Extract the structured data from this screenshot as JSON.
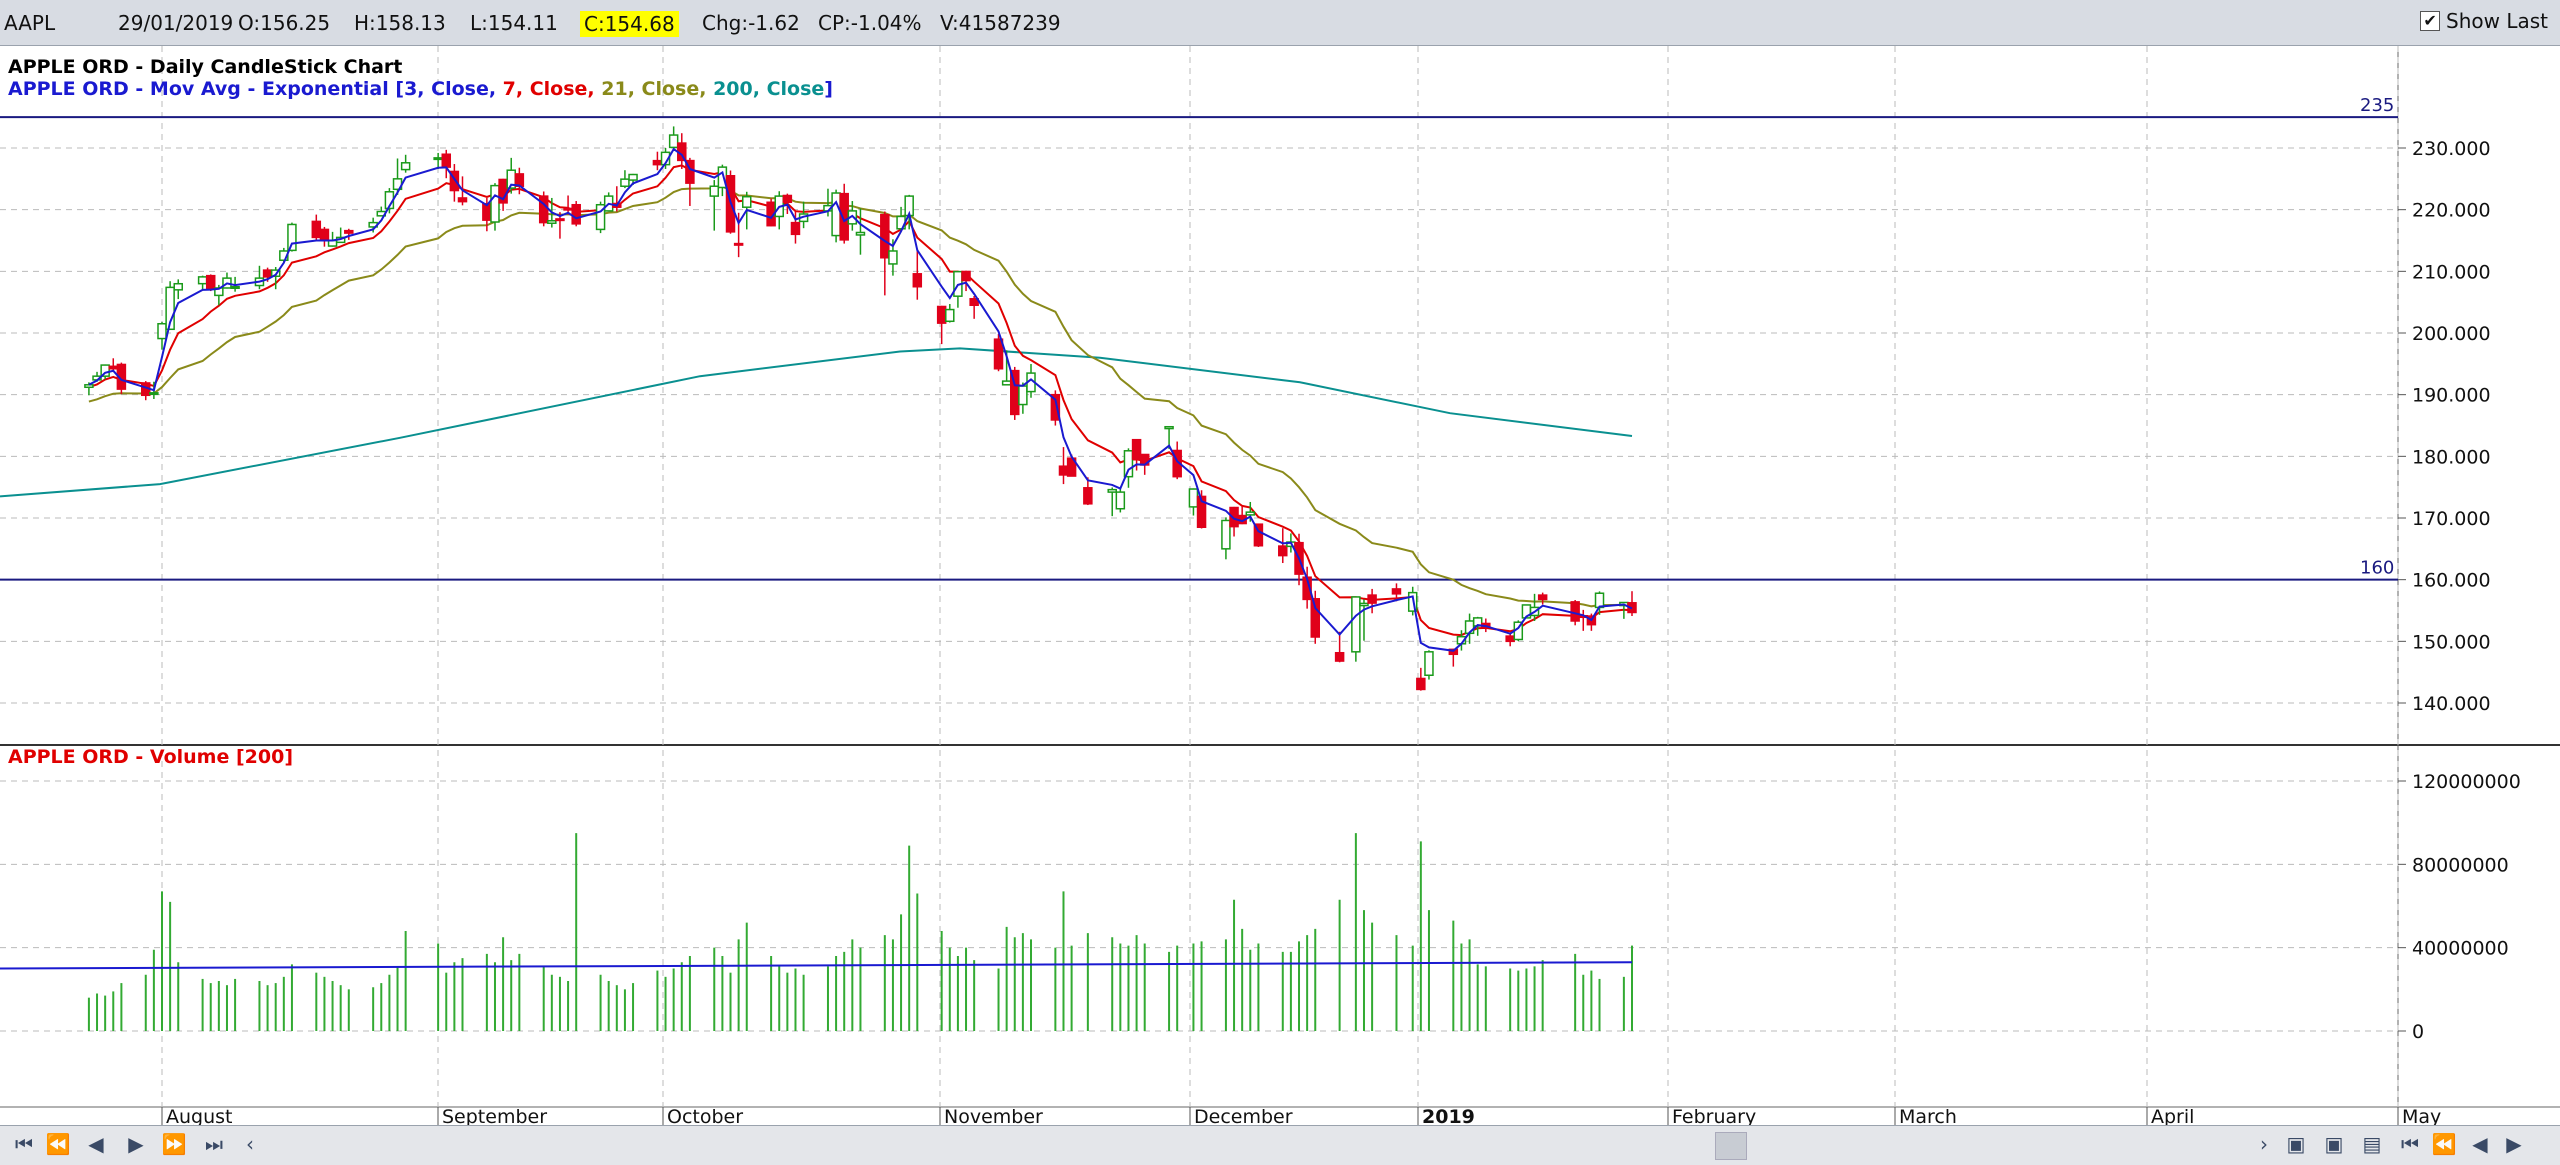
{
  "quote": {
    "symbol": "AAPL",
    "date": "29/01/2019",
    "open": "O:156.25",
    "high": "H:158.13",
    "low": "L:154.11",
    "close": "C:154.68",
    "change": "Chg:-1.62",
    "change_pct": "CP:-1.04%",
    "volume": "V:41587239",
    "show_last_label": "Show Last",
    "show_last_checked": true
  },
  "legend": {
    "price_title": "APPLE ORD - Daily CandleStick Chart",
    "ma_prefix": "APPLE ORD - Mov Avg - Exponential [",
    "ma_parts": [
      {
        "text": "3, Close",
        "color": "#1a1ad0"
      },
      {
        "text": "7, Close",
        "color": "#e00000"
      },
      {
        "text": "21, Close",
        "color": "#8a8a1a"
      },
      {
        "text": "200, Close",
        "color": "#0a9090"
      }
    ],
    "ma_suffix": "]",
    "volume_title": "APPLE ORD - Volume [200]"
  },
  "colors": {
    "up": "#1a9a1a",
    "down": "#e0001a",
    "ema3": "#1a1ad0",
    "ema7": "#e00000",
    "ema21": "#8a8a1a",
    "ema200": "#0a9090",
    "vol_bar": "#33aa33",
    "vol_ma": "#1a1ad0",
    "hline": "#1a1a80"
  },
  "nav_icons": [
    "first-icon",
    "rewind-icon",
    "step-back-icon",
    "step-forward-icon",
    "fast-forward-icon",
    "last-icon",
    "scroll-left-icon"
  ],
  "chart_data": {
    "type": "candlestick",
    "x_axis_labels": [
      "August",
      "September",
      "October",
      "November",
      "December",
      "2019",
      "February",
      "March",
      "April",
      "May"
    ],
    "price_axis": {
      "ylim": [
        134,
        236
      ],
      "ticks": [
        "230.000",
        "220.000",
        "210.000",
        "200.000",
        "190.000",
        "180.000",
        "170.000",
        "160.000",
        "150.000",
        "140.000"
      ]
    },
    "volume_axis": {
      "ylim": [
        -20000000,
        128000000
      ],
      "ticks": [
        "120000000",
        "80000000",
        "40000000",
        "0"
      ]
    },
    "horizontal_lines": [
      {
        "value": 235,
        "label": "235"
      },
      {
        "value": 160,
        "label": "160"
      }
    ],
    "candles": [
      {
        "d": "2018-07-23",
        "o": 191.2,
        "h": 192.0,
        "l": 189.9,
        "c": 191.6
      },
      {
        "d": "2018-07-24",
        "o": 192.4,
        "h": 193.7,
        "l": 192.1,
        "c": 193.0
      },
      {
        "d": "2018-07-25",
        "o": 193.0,
        "h": 194.9,
        "l": 192.5,
        "c": 194.8
      },
      {
        "d": "2018-07-26",
        "o": 194.6,
        "h": 195.9,
        "l": 193.8,
        "c": 194.2
      },
      {
        "d": "2018-07-27",
        "o": 194.9,
        "h": 195.2,
        "l": 190.1,
        "c": 190.9
      },
      {
        "d": "2018-07-30",
        "o": 191.9,
        "h": 192.2,
        "l": 189.1,
        "c": 189.9
      },
      {
        "d": "2018-07-31",
        "o": 190.3,
        "h": 192.1,
        "l": 189.3,
        "c": 190.3
      },
      {
        "d": "2018-08-01",
        "o": 199.1,
        "h": 201.8,
        "l": 197.3,
        "c": 201.5
      },
      {
        "d": "2018-08-02",
        "o": 200.6,
        "h": 208.4,
        "l": 200.5,
        "c": 207.4
      },
      {
        "d": "2018-08-03",
        "o": 207.0,
        "h": 208.7,
        "l": 205.5,
        "c": 207.99
      },
      {
        "d": "2018-08-06",
        "o": 208.0,
        "h": 209.3,
        "l": 207.1,
        "c": 209.1
      },
      {
        "d": "2018-08-07",
        "o": 209.3,
        "h": 209.5,
        "l": 206.8,
        "c": 207.1
      },
      {
        "d": "2018-08-08",
        "o": 206.1,
        "h": 207.8,
        "l": 204.5,
        "c": 207.3
      },
      {
        "d": "2018-08-09",
        "o": 207.3,
        "h": 209.8,
        "l": 207.2,
        "c": 208.9
      },
      {
        "d": "2018-08-10",
        "o": 207.4,
        "h": 209.1,
        "l": 206.7,
        "c": 207.5
      },
      {
        "d": "2018-08-13",
        "o": 207.7,
        "h": 210.9,
        "l": 207.1,
        "c": 208.9
      },
      {
        "d": "2018-08-14",
        "o": 210.2,
        "h": 210.6,
        "l": 208.3,
        "c": 209.1
      },
      {
        "d": "2018-08-15",
        "o": 209.2,
        "h": 210.7,
        "l": 207.1,
        "c": 210.2
      },
      {
        "d": "2018-08-16",
        "o": 211.8,
        "h": 213.8,
        "l": 211.5,
        "c": 213.3
      },
      {
        "d": "2018-08-17",
        "o": 213.4,
        "h": 217.9,
        "l": 213.2,
        "c": 217.6
      },
      {
        "d": "2018-08-20",
        "o": 218.1,
        "h": 219.2,
        "l": 215.1,
        "c": 215.5
      },
      {
        "d": "2018-08-21",
        "o": 216.8,
        "h": 217.2,
        "l": 214.0,
        "c": 215.0
      },
      {
        "d": "2018-08-22",
        "o": 214.1,
        "h": 216.4,
        "l": 214.0,
        "c": 215.0
      },
      {
        "d": "2018-08-23",
        "o": 214.7,
        "h": 217.1,
        "l": 214.6,
        "c": 215.5
      },
      {
        "d": "2018-08-24",
        "o": 216.6,
        "h": 216.9,
        "l": 215.1,
        "c": 216.2
      },
      {
        "d": "2018-08-27",
        "o": 217.2,
        "h": 218.7,
        "l": 216.3,
        "c": 217.9
      },
      {
        "d": "2018-08-28",
        "o": 219.0,
        "h": 220.5,
        "l": 218.9,
        "c": 219.7
      },
      {
        "d": "2018-08-29",
        "o": 220.2,
        "h": 223.5,
        "l": 219.4,
        "c": 222.9
      },
      {
        "d": "2018-08-30",
        "o": 223.3,
        "h": 228.3,
        "l": 222.4,
        "c": 225.0
      },
      {
        "d": "2018-08-31",
        "o": 226.5,
        "h": 228.9,
        "l": 226.0,
        "c": 227.6
      },
      {
        "d": "2018-09-04",
        "o": 228.4,
        "h": 229.2,
        "l": 226.6,
        "c": 228.4
      },
      {
        "d": "2018-09-05",
        "o": 228.99,
        "h": 229.7,
        "l": 225.1,
        "c": 226.9
      },
      {
        "d": "2018-09-06",
        "o": 226.2,
        "h": 227.4,
        "l": 221.3,
        "c": 223.1
      },
      {
        "d": "2018-09-07",
        "o": 221.9,
        "h": 225.4,
        "l": 220.7,
        "c": 221.3
      },
      {
        "d": "2018-09-10",
        "o": 220.95,
        "h": 221.9,
        "l": 216.5,
        "c": 218.3
      },
      {
        "d": "2018-09-11",
        "o": 218.0,
        "h": 224.3,
        "l": 216.6,
        "c": 223.9
      },
      {
        "d": "2018-09-12",
        "o": 224.9,
        "h": 225.0,
        "l": 219.8,
        "c": 221.1
      },
      {
        "d": "2018-09-13",
        "o": 223.5,
        "h": 228.4,
        "l": 222.6,
        "c": 226.4
      },
      {
        "d": "2018-09-14",
        "o": 225.8,
        "h": 226.8,
        "l": 222.5,
        "c": 223.8
      },
      {
        "d": "2018-09-17",
        "o": 222.2,
        "h": 222.95,
        "l": 217.3,
        "c": 217.9
      },
      {
        "d": "2018-09-18",
        "o": 217.8,
        "h": 221.9,
        "l": 217.1,
        "c": 218.2
      },
      {
        "d": "2018-09-19",
        "o": 218.5,
        "h": 219.6,
        "l": 215.3,
        "c": 218.4
      },
      {
        "d": "2018-09-20",
        "o": 220.2,
        "h": 222.3,
        "l": 219.2,
        "c": 220.0
      },
      {
        "d": "2018-09-21",
        "o": 220.8,
        "h": 221.4,
        "l": 217.3,
        "c": 217.7
      },
      {
        "d": "2018-09-24",
        "o": 216.8,
        "h": 221.3,
        "l": 216.2,
        "c": 220.8
      },
      {
        "d": "2018-09-25",
        "o": 219.8,
        "h": 222.8,
        "l": 219.7,
        "c": 222.2
      },
      {
        "d": "2018-09-26",
        "o": 221.0,
        "h": 223.8,
        "l": 219.7,
        "c": 220.4
      },
      {
        "d": "2018-09-27",
        "o": 223.8,
        "h": 226.4,
        "l": 223.5,
        "c": 224.95
      },
      {
        "d": "2018-09-28",
        "o": 224.8,
        "h": 225.8,
        "l": 224.0,
        "c": 225.7
      },
      {
        "d": "2018-10-01",
        "o": 227.95,
        "h": 229.4,
        "l": 226.4,
        "c": 227.3
      },
      {
        "d": "2018-10-02",
        "o": 227.3,
        "h": 230.0,
        "l": 226.6,
        "c": 229.3
      },
      {
        "d": "2018-10-03",
        "o": 230.1,
        "h": 233.5,
        "l": 229.8,
        "c": 232.1
      },
      {
        "d": "2018-10-04",
        "o": 230.8,
        "h": 232.4,
        "l": 226.6,
        "c": 227.99
      },
      {
        "d": "2018-10-05",
        "o": 227.96,
        "h": 228.4,
        "l": 220.6,
        "c": 224.3
      },
      {
        "d": "2018-10-08",
        "o": 222.2,
        "h": 224.8,
        "l": 216.6,
        "c": 223.8
      },
      {
        "d": "2018-10-09",
        "o": 223.6,
        "h": 227.3,
        "l": 222.2,
        "c": 226.9
      },
      {
        "d": "2018-10-10",
        "o": 225.5,
        "h": 226.35,
        "l": 216.1,
        "c": 216.4
      },
      {
        "d": "2018-10-11",
        "o": 214.5,
        "h": 219.5,
        "l": 212.3,
        "c": 214.45
      },
      {
        "d": "2018-10-12",
        "o": 220.4,
        "h": 222.9,
        "l": 216.8,
        "c": 222.1
      },
      {
        "d": "2018-10-15",
        "o": 221.2,
        "h": 221.8,
        "l": 217.3,
        "c": 217.4
      },
      {
        "d": "2018-10-16",
        "o": 218.9,
        "h": 222.99,
        "l": 216.8,
        "c": 222.2
      },
      {
        "d": "2018-10-17",
        "o": 222.3,
        "h": 222.6,
        "l": 219.3,
        "c": 221.2
      },
      {
        "d": "2018-10-18",
        "o": 217.9,
        "h": 219.7,
        "l": 214.5,
        "c": 216.0
      },
      {
        "d": "2018-10-19",
        "o": 218.1,
        "h": 221.3,
        "l": 217.0,
        "c": 219.3
      },
      {
        "d": "2018-10-22",
        "o": 219.8,
        "h": 223.4,
        "l": 218.9,
        "c": 220.65
      },
      {
        "d": "2018-10-23",
        "o": 215.8,
        "h": 223.25,
        "l": 214.7,
        "c": 222.7
      },
      {
        "d": "2018-10-24",
        "o": 222.6,
        "h": 224.2,
        "l": 214.5,
        "c": 215.1
      },
      {
        "d": "2018-10-25",
        "o": 217.7,
        "h": 221.4,
        "l": 216.6,
        "c": 219.8
      },
      {
        "d": "2018-10-26",
        "o": 215.9,
        "h": 220.2,
        "l": 212.7,
        "c": 216.3
      },
      {
        "d": "2018-10-29",
        "o": 219.2,
        "h": 219.7,
        "l": 206.1,
        "c": 212.2
      },
      {
        "d": "2018-10-30",
        "o": 211.2,
        "h": 215.2,
        "l": 209.3,
        "c": 213.3
      },
      {
        "d": "2018-10-31",
        "o": 216.9,
        "h": 220.45,
        "l": 216.6,
        "c": 218.9
      },
      {
        "d": "2018-11-01",
        "o": 219.05,
        "h": 222.4,
        "l": 216.8,
        "c": 222.2
      },
      {
        "d": "2018-11-02",
        "o": 209.6,
        "h": 213.65,
        "l": 205.4,
        "c": 207.5
      },
      {
        "d": "2018-11-05",
        "o": 204.3,
        "h": 204.4,
        "l": 198.2,
        "c": 201.6
      },
      {
        "d": "2018-11-06",
        "o": 201.9,
        "h": 204.7,
        "l": 201.7,
        "c": 203.8
      },
      {
        "d": "2018-11-07",
        "o": 205.97,
        "h": 210.06,
        "l": 204.1,
        "c": 209.95
      },
      {
        "d": "2018-11-08",
        "o": 209.98,
        "h": 210.1,
        "l": 206.8,
        "c": 208.5
      },
      {
        "d": "2018-11-09",
        "o": 205.55,
        "h": 206.0,
        "l": 202.3,
        "c": 204.5
      },
      {
        "d": "2018-11-12",
        "o": 199.0,
        "h": 199.85,
        "l": 193.8,
        "c": 194.2
      },
      {
        "d": "2018-11-13",
        "o": 191.6,
        "h": 197.2,
        "l": 191.5,
        "c": 192.2
      },
      {
        "d": "2018-11-14",
        "o": 193.9,
        "h": 194.5,
        "l": 185.9,
        "c": 186.8
      },
      {
        "d": "2018-11-15",
        "o": 188.4,
        "h": 191.97,
        "l": 186.9,
        "c": 191.4
      },
      {
        "d": "2018-11-16",
        "o": 190.5,
        "h": 194.97,
        "l": 189.5,
        "c": 193.5
      },
      {
        "d": "2018-11-19",
        "o": 190.0,
        "h": 190.7,
        "l": 184.99,
        "c": 185.9
      },
      {
        "d": "2018-11-20",
        "o": 178.4,
        "h": 181.5,
        "l": 175.5,
        "c": 176.98
      },
      {
        "d": "2018-11-21",
        "o": 179.7,
        "h": 180.3,
        "l": 176.8,
        "c": 176.8
      },
      {
        "d": "2018-11-23",
        "o": 174.9,
        "h": 176.6,
        "l": 172.1,
        "c": 172.3
      },
      {
        "d": "2018-11-26",
        "o": 174.2,
        "h": 174.95,
        "l": 170.3,
        "c": 174.6
      },
      {
        "d": "2018-11-27",
        "o": 171.5,
        "h": 174.8,
        "l": 170.9,
        "c": 174.2
      },
      {
        "d": "2018-11-28",
        "o": 176.7,
        "h": 181.3,
        "l": 174.9,
        "c": 180.9
      },
      {
        "d": "2018-11-29",
        "o": 182.7,
        "h": 182.8,
        "l": 177.7,
        "c": 179.55
      },
      {
        "d": "2018-11-30",
        "o": 180.3,
        "h": 180.3,
        "l": 177.0,
        "c": 178.6
      },
      {
        "d": "2018-12-03",
        "o": 184.5,
        "h": 184.9,
        "l": 181.2,
        "c": 184.8
      },
      {
        "d": "2018-12-04",
        "o": 180.95,
        "h": 182.4,
        "l": 176.3,
        "c": 176.7
      },
      {
        "d": "2018-12-06",
        "o": 171.8,
        "h": 174.8,
        "l": 170.4,
        "c": 174.7
      },
      {
        "d": "2018-12-07",
        "o": 173.5,
        "h": 174.5,
        "l": 168.3,
        "c": 168.5
      },
      {
        "d": "2018-12-10",
        "o": 165.0,
        "h": 170.1,
        "l": 163.3,
        "c": 169.6
      },
      {
        "d": "2018-12-11",
        "o": 171.7,
        "h": 171.8,
        "l": 167.0,
        "c": 168.6
      },
      {
        "d": "2018-12-12",
        "o": 170.4,
        "h": 171.9,
        "l": 169.0,
        "c": 169.1
      },
      {
        "d": "2018-12-13",
        "o": 170.5,
        "h": 172.6,
        "l": 169.4,
        "c": 170.95
      },
      {
        "d": "2018-12-14",
        "o": 169.0,
        "h": 169.1,
        "l": 165.3,
        "c": 165.5
      },
      {
        "d": "2018-12-17",
        "o": 165.45,
        "h": 168.35,
        "l": 162.7,
        "c": 163.9
      },
      {
        "d": "2018-12-18",
        "o": 165.4,
        "h": 167.5,
        "l": 164.4,
        "c": 166.1
      },
      {
        "d": "2018-12-19",
        "o": 166.0,
        "h": 167.45,
        "l": 159.1,
        "c": 160.9
      },
      {
        "d": "2018-12-20",
        "o": 160.4,
        "h": 162.1,
        "l": 155.3,
        "c": 156.8
      },
      {
        "d": "2018-12-21",
        "o": 156.9,
        "h": 158.2,
        "l": 149.6,
        "c": 150.7
      },
      {
        "d": "2018-12-24",
        "o": 148.15,
        "h": 151.55,
        "l": 146.6,
        "c": 146.8
      },
      {
        "d": "2018-12-26",
        "o": 148.3,
        "h": 157.2,
        "l": 146.7,
        "c": 157.2
      },
      {
        "d": "2018-12-27",
        "o": 155.8,
        "h": 156.8,
        "l": 150.1,
        "c": 156.15
      },
      {
        "d": "2018-12-28",
        "o": 157.5,
        "h": 158.5,
        "l": 154.55,
        "c": 156.2
      },
      {
        "d": "2018-12-31",
        "o": 158.5,
        "h": 159.4,
        "l": 156.5,
        "c": 157.7
      },
      {
        "d": "2019-01-02",
        "o": 154.9,
        "h": 158.85,
        "l": 154.2,
        "c": 157.9
      },
      {
        "d": "2019-01-03",
        "o": 143.98,
        "h": 145.7,
        "l": 142.0,
        "c": 142.2
      },
      {
        "d": "2019-01-04",
        "o": 144.5,
        "h": 148.55,
        "l": 143.8,
        "c": 148.3
      },
      {
        "d": "2019-01-07",
        "o": 148.7,
        "h": 148.8,
        "l": 145.9,
        "c": 147.9
      },
      {
        "d": "2019-01-08",
        "o": 149.6,
        "h": 151.8,
        "l": 148.5,
        "c": 150.75
      },
      {
        "d": "2019-01-09",
        "o": 151.3,
        "h": 154.5,
        "l": 149.6,
        "c": 153.3
      },
      {
        "d": "2019-01-10",
        "o": 152.5,
        "h": 153.97,
        "l": 150.9,
        "c": 153.8
      },
      {
        "d": "2019-01-11",
        "o": 152.9,
        "h": 153.7,
        "l": 151.5,
        "c": 152.3
      },
      {
        "d": "2019-01-14",
        "o": 150.85,
        "h": 151.3,
        "l": 149.2,
        "c": 150.0
      },
      {
        "d": "2019-01-15",
        "o": 150.3,
        "h": 153.4,
        "l": 150.05,
        "c": 153.1
      },
      {
        "d": "2019-01-16",
        "o": 153.8,
        "h": 155.9,
        "l": 153.8,
        "c": 155.9
      },
      {
        "d": "2019-01-17",
        "o": 154.2,
        "h": 157.7,
        "l": 153.3,
        "c": 155.5
      },
      {
        "d": "2019-01-18",
        "o": 157.5,
        "h": 157.9,
        "l": 155.98,
        "c": 156.8
      },
      {
        "d": "2019-01-22",
        "o": 156.4,
        "h": 156.7,
        "l": 152.6,
        "c": 153.3
      },
      {
        "d": "2019-01-23",
        "o": 154.15,
        "h": 155.1,
        "l": 151.7,
        "c": 153.9
      },
      {
        "d": "2019-01-24",
        "o": 154.1,
        "h": 154.5,
        "l": 151.7,
        "c": 152.7
      },
      {
        "d": "2019-01-25",
        "o": 155.5,
        "h": 158.1,
        "l": 154.3,
        "c": 157.8
      },
      {
        "d": "2019-01-28",
        "o": 155.8,
        "h": 156.3,
        "l": 153.65,
        "c": 156.3
      },
      {
        "d": "2019-01-29",
        "o": 156.25,
        "h": 158.13,
        "l": 154.11,
        "c": 154.68
      }
    ],
    "volumes": [
      16,
      18,
      17,
      19,
      23,
      27,
      39,
      67,
      62,
      33,
      25,
      23,
      24,
      22,
      25,
      24,
      22,
      23,
      26,
      32,
      28,
      26,
      24,
      22,
      20,
      21,
      23,
      27,
      31,
      48,
      42,
      28,
      33,
      35,
      37,
      33,
      45,
      34,
      37,
      31,
      27,
      26,
      24,
      95,
      27,
      24,
      22,
      20,
      23,
      29,
      26,
      30,
      33,
      36,
      40,
      36,
      28,
      44,
      52,
      36,
      31,
      28,
      30,
      27,
      31,
      36,
      38,
      44,
      40,
      46,
      44,
      56,
      89,
      66,
      48,
      40,
      36,
      40,
      34,
      30,
      50,
      45,
      47,
      44,
      40,
      67,
      41,
      47,
      45,
      42,
      41,
      46,
      42,
      38,
      41,
      42,
      43,
      44,
      63,
      49,
      39,
      42,
      38,
      38,
      43,
      46,
      49,
      63,
      95,
      58,
      52,
      46,
      41,
      91,
      58,
      53,
      42,
      44,
      32,
      31,
      30,
      29,
      30,
      31,
      34,
      37,
      27,
      29,
      25,
      26,
      41
    ],
    "volume_unit": 1000000,
    "volume_ma_level": 30000000
  }
}
